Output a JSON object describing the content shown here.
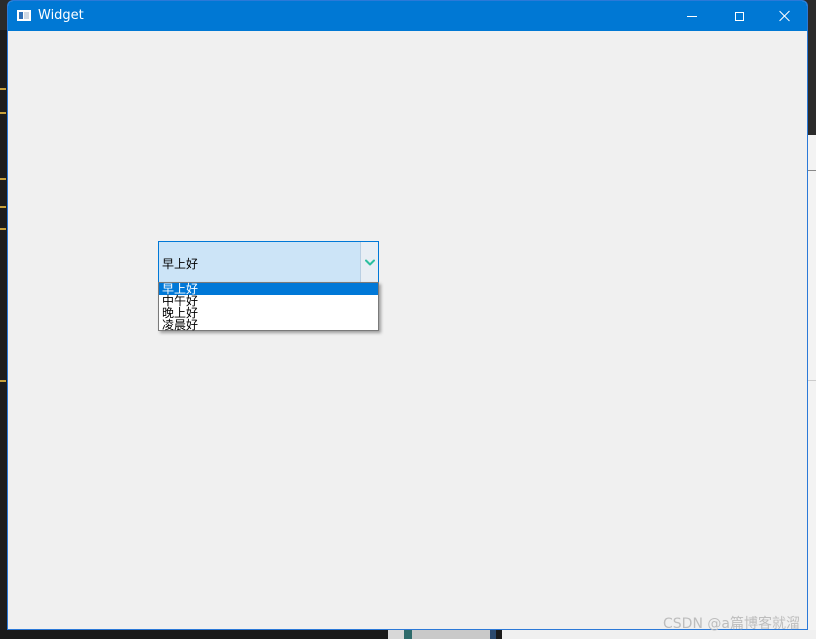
{
  "window": {
    "title": "Widget"
  },
  "combo": {
    "value": "早上好",
    "options": [
      "早上好",
      "中午好",
      "晚上好",
      "凌晨好"
    ],
    "selected_index": 0
  },
  "colors": {
    "titlebar": "#0078d4",
    "selection": "#0078d7",
    "combo_bg": "#cce4f7",
    "arrow": "#2dbf9f"
  },
  "icons": {
    "dropdown": "chevron-down-icon",
    "minimize": "minimize-icon",
    "maximize": "maximize-icon",
    "close": "close-icon"
  },
  "watermark": "CSDN @a篇博客就溜"
}
